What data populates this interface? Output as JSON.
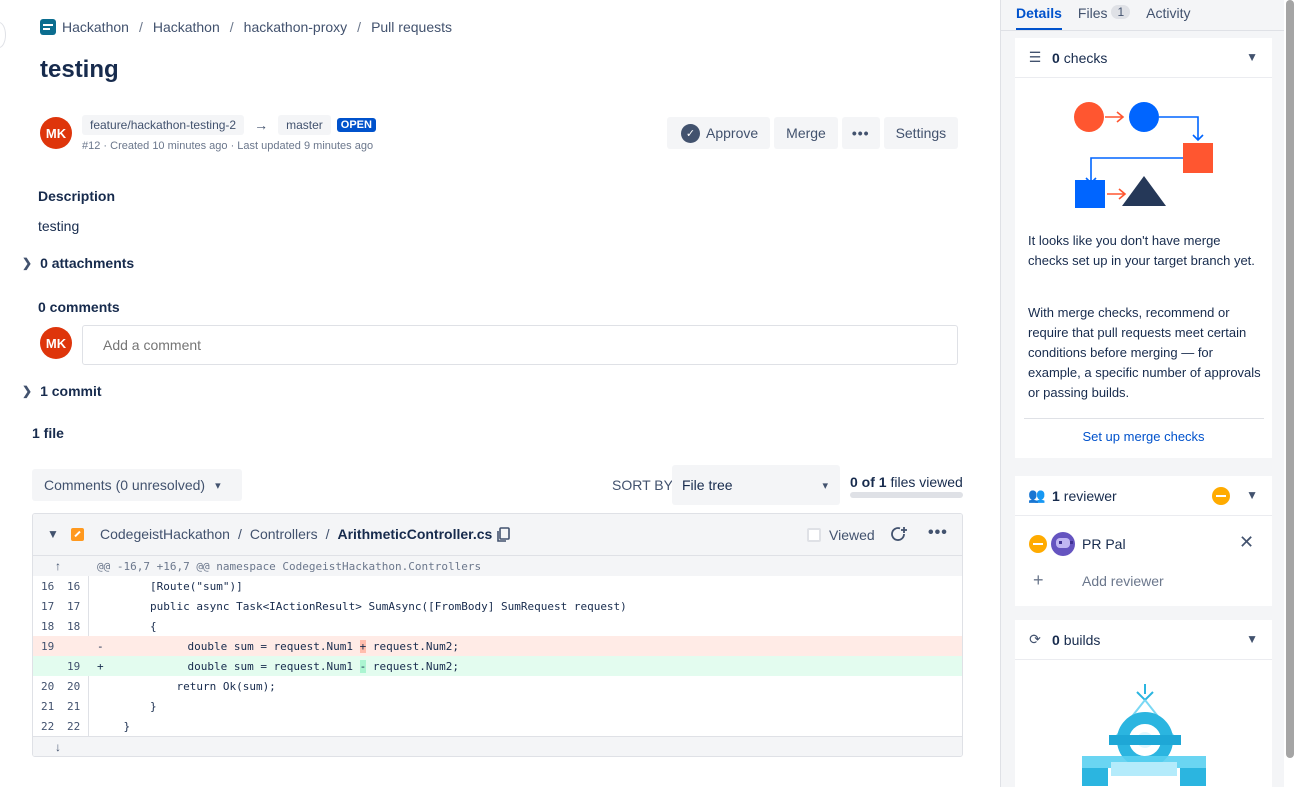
{
  "breadcrumb": {
    "items": [
      "Hackathon",
      "Hackathon",
      "hackathon-proxy",
      "Pull requests"
    ],
    "separator": "/"
  },
  "pr": {
    "title": "testing",
    "author_initials": "MK",
    "source_branch": "feature/hackathon-testing-2",
    "target_branch": "master",
    "state": "OPEN",
    "meta": "#12 · Created 10 minutes ago · Last updated 9 minutes ago"
  },
  "actions": {
    "approve_label": "Approve",
    "merge_label": "Merge",
    "more_label": "•••",
    "settings_label": "Settings"
  },
  "description": {
    "heading": "Description",
    "text": "testing"
  },
  "attachments_label": "0 attachments",
  "comments": {
    "heading": "0 comments",
    "avatar_initials": "MK",
    "placeholder": "Add a comment"
  },
  "commits_label": "1 commit",
  "files": {
    "heading": "1 file",
    "comments_filter": "Comments (0 unresolved)",
    "sort_by_label": "SORT BY",
    "sort_value": "File tree",
    "viewed_count": "0 of 1",
    "viewed_suffix": "files viewed"
  },
  "diff": {
    "path": [
      "CodegeistHackathon",
      "Controllers"
    ],
    "filename": "ArithmeticController.cs",
    "viewed_label": "Viewed",
    "hunk_header": "@@ -16,7 +16,7 @@ namespace CodegeistHackathon.Controllers",
    "lines": [
      {
        "old": "16",
        "new": "16",
        "type": "context",
        "code": "        [Route(\"sum\")]"
      },
      {
        "old": "17",
        "new": "17",
        "type": "context",
        "code": "        public async Task<IActionResult> SumAsync([FromBody] SumRequest request)"
      },
      {
        "old": "18",
        "new": "18",
        "type": "context",
        "code": "        {"
      },
      {
        "old": "19",
        "new": "",
        "type": "del",
        "marker": "-",
        "before": "            double sum = request.Num1 ",
        "hl": "+",
        "after": " request.Num2;"
      },
      {
        "old": "",
        "new": "19",
        "type": "add",
        "marker": "+",
        "before": "            double sum = request.Num1 ",
        "hl": "-",
        "after": " request.Num2;"
      },
      {
        "old": "20",
        "new": "20",
        "type": "context",
        "code": "            return Ok(sum);"
      },
      {
        "old": "21",
        "new": "21",
        "type": "context",
        "code": "        }"
      },
      {
        "old": "22",
        "new": "22",
        "type": "context",
        "code": "    }"
      }
    ]
  },
  "sidebar": {
    "tabs": [
      {
        "label": "Details",
        "active": true
      },
      {
        "label": "Files",
        "count": "1"
      },
      {
        "label": "Activity"
      }
    ],
    "checks": {
      "count": "0",
      "label": "checks",
      "text1": "It looks like you don't have merge checks set up in your target branch yet.",
      "text2": "With merge checks, recommend or require that pull requests meet certain conditions before merging — for example, a specific number of approvals or passing builds.",
      "link": "Set up merge checks"
    },
    "reviewers": {
      "count": "1",
      "label": "reviewer",
      "items": [
        {
          "name": "PR Pal"
        }
      ],
      "add_label": "Add reviewer"
    },
    "builds": {
      "count": "0",
      "label": "builds"
    }
  },
  "colors": {
    "accent": "#0052cc",
    "open_badge": "#0052cc",
    "avatar": "#de350b",
    "pending": "#ffab00",
    "del_bg": "#ffebe6",
    "add_bg": "#e3fcef"
  }
}
